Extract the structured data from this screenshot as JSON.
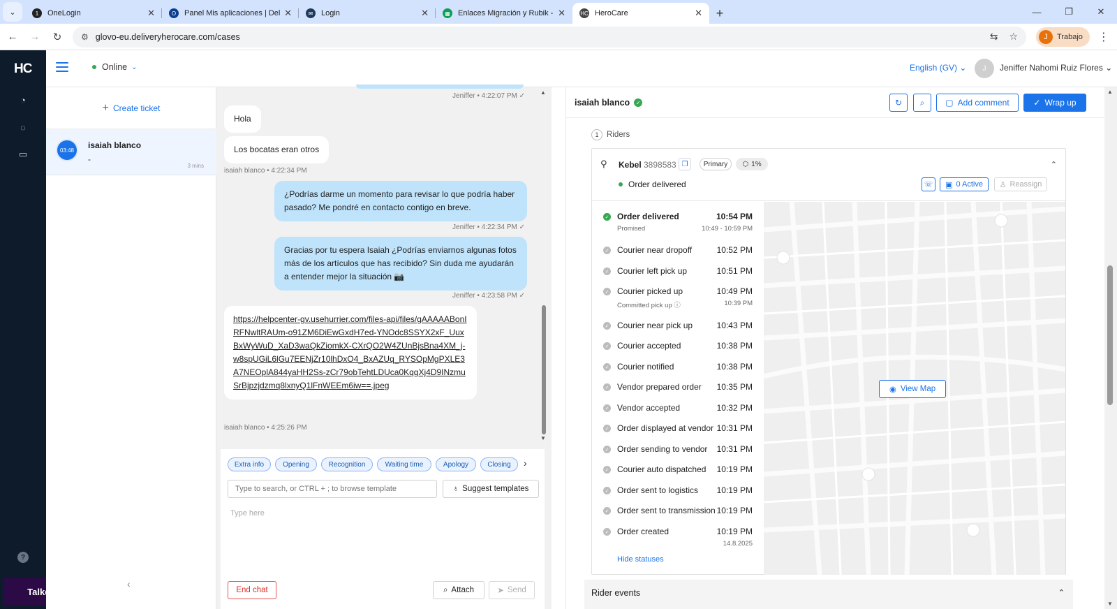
{
  "browser": {
    "tabs": [
      {
        "title": "OneLogin",
        "favicon_color": "#222222",
        "favicon_glyph": "1"
      },
      {
        "title": "Panel Mis aplicaciones | Deliver",
        "favicon_color": "#0b3d91",
        "favicon_glyph": "O"
      },
      {
        "title": "Login",
        "favicon_color": "#1f3a5f",
        "favicon_glyph": "✉"
      },
      {
        "title": "Enlaces Migración y Rubik - Go",
        "favicon_color": "#0f9d58",
        "favicon_glyph": "▦"
      },
      {
        "title": "HeroCare",
        "favicon_color": "#444444",
        "favicon_glyph": "HC"
      }
    ],
    "active_tab_index": 4,
    "url": "glovo-eu.deliveryherocare.com/cases",
    "profile_initial": "J",
    "profile_label": "Trabajo"
  },
  "app": {
    "logo": "HC",
    "talkdesk_label": "Talkdesk",
    "status": "Online",
    "language": "English (GV)",
    "user_initial": "J",
    "user_name": "Jeniffer Nahomi Ruiz Flores"
  },
  "caselist": {
    "create_ticket": "Create ticket",
    "cases": [
      {
        "timer": "03:48",
        "name": "isaiah blanco",
        "subtitle": "-",
        "age": "3 mins"
      }
    ]
  },
  "chat": {
    "messages": [
      {
        "dir": "meta-out",
        "meta": "Jeniffer • 4:22:07 PM"
      },
      {
        "dir": "in",
        "text": "Hola"
      },
      {
        "dir": "in",
        "text": "Los bocatas eran otros"
      },
      {
        "dir": "meta-in",
        "meta": "isaiah blanco • 4:22:34 PM"
      },
      {
        "dir": "out",
        "text": "¿Podrías darme un momento para revisar lo que podría haber pasado? Me pondré en contacto contigo en breve."
      },
      {
        "dir": "meta-out",
        "meta": "Jeniffer • 4:22:34 PM"
      },
      {
        "dir": "out",
        "text": "Gracias por tu espera Isaiah ¿Podrías enviarnos algunas fotos más de los artículos que has recibido? Sin duda me ayudarán a entender mejor la situación 📷"
      },
      {
        "dir": "meta-out",
        "meta": "Jeniffer • 4:23:58 PM"
      },
      {
        "dir": "in-link",
        "text": "https://helpcenter-gv.usehurrier.com/files-api/files/gAAAAABonIRFNwltRAUm-o91ZM6DiEwGxdH7ed-YNOdc8SSYX2xF_UuxBxWyWuD_XaD3waQkZiomkX-CXrQO2W4ZUnBjsBna4XM_j-w8spUGiL6lGu7EENjZr10lhDxO4_BxAZUq_RYSOpMgPXLE3A7NEOplA844yaHH2Ss-zCr79obTehtLDUca0KqgXj4D9INzmuSrBjpzjdzmq8lxnyQ1lFnWEEm6iw==.jpeg"
      },
      {
        "dir": "meta-in",
        "meta": "isaiah blanco • 4:25:26 PM"
      }
    ],
    "quick_chips": [
      "Extra info",
      "Opening",
      "Recognition",
      "Waiting time",
      "Apology",
      "Closing"
    ],
    "template_placeholder": "Type to search, or CTRL + ; to browse template",
    "suggest_label": "Suggest templates",
    "message_placeholder": "Type here",
    "end_chat": "End chat",
    "attach": "Attach",
    "send": "Send"
  },
  "panel": {
    "customer_name": "isaiah blanco",
    "add_comment": "Add comment",
    "wrap_up": "Wrap up",
    "riders_count": "1",
    "riders_label": "Riders",
    "rider": {
      "name": "Kebel",
      "id": "3898583",
      "role": "Primary",
      "score": "1%",
      "status": "Order delivered",
      "active": "0 Active",
      "reassign": "Reassign"
    },
    "timeline": [
      {
        "label": "Order delivered",
        "time": "10:54 PM",
        "done": true,
        "sub": "Promised",
        "subtime": "10:49 - 10:59 PM"
      },
      {
        "label": "Courier near dropoff",
        "time": "10:52 PM"
      },
      {
        "label": "Courier left pick up",
        "time": "10:51 PM"
      },
      {
        "label": "Courier picked up",
        "time": "10:49 PM",
        "sub": "Committed pick up ⓘ",
        "subtime": "10:39 PM"
      },
      {
        "label": "Courier near pick up",
        "time": "10:43 PM"
      },
      {
        "label": "Courier accepted",
        "time": "10:38 PM"
      },
      {
        "label": "Courier notified",
        "time": "10:38 PM"
      },
      {
        "label": "Vendor prepared order",
        "time": "10:35 PM"
      },
      {
        "label": "Vendor accepted",
        "time": "10:32 PM"
      },
      {
        "label": "Order displayed at vendor",
        "time": "10:31 PM"
      },
      {
        "label": "Order sending to vendor",
        "time": "10:31 PM"
      },
      {
        "label": "Courier auto dispatched",
        "time": "10:19 PM"
      },
      {
        "label": "Order sent to logistics",
        "time": "10:19 PM"
      },
      {
        "label": "Order sent to transmission",
        "time": "10:19 PM"
      },
      {
        "label": "Order created",
        "time": "10:19 PM",
        "subtime": "14.8.2025"
      }
    ],
    "hide_statuses": "Hide statuses",
    "view_map": "View Map",
    "rider_events": "Rider events"
  }
}
